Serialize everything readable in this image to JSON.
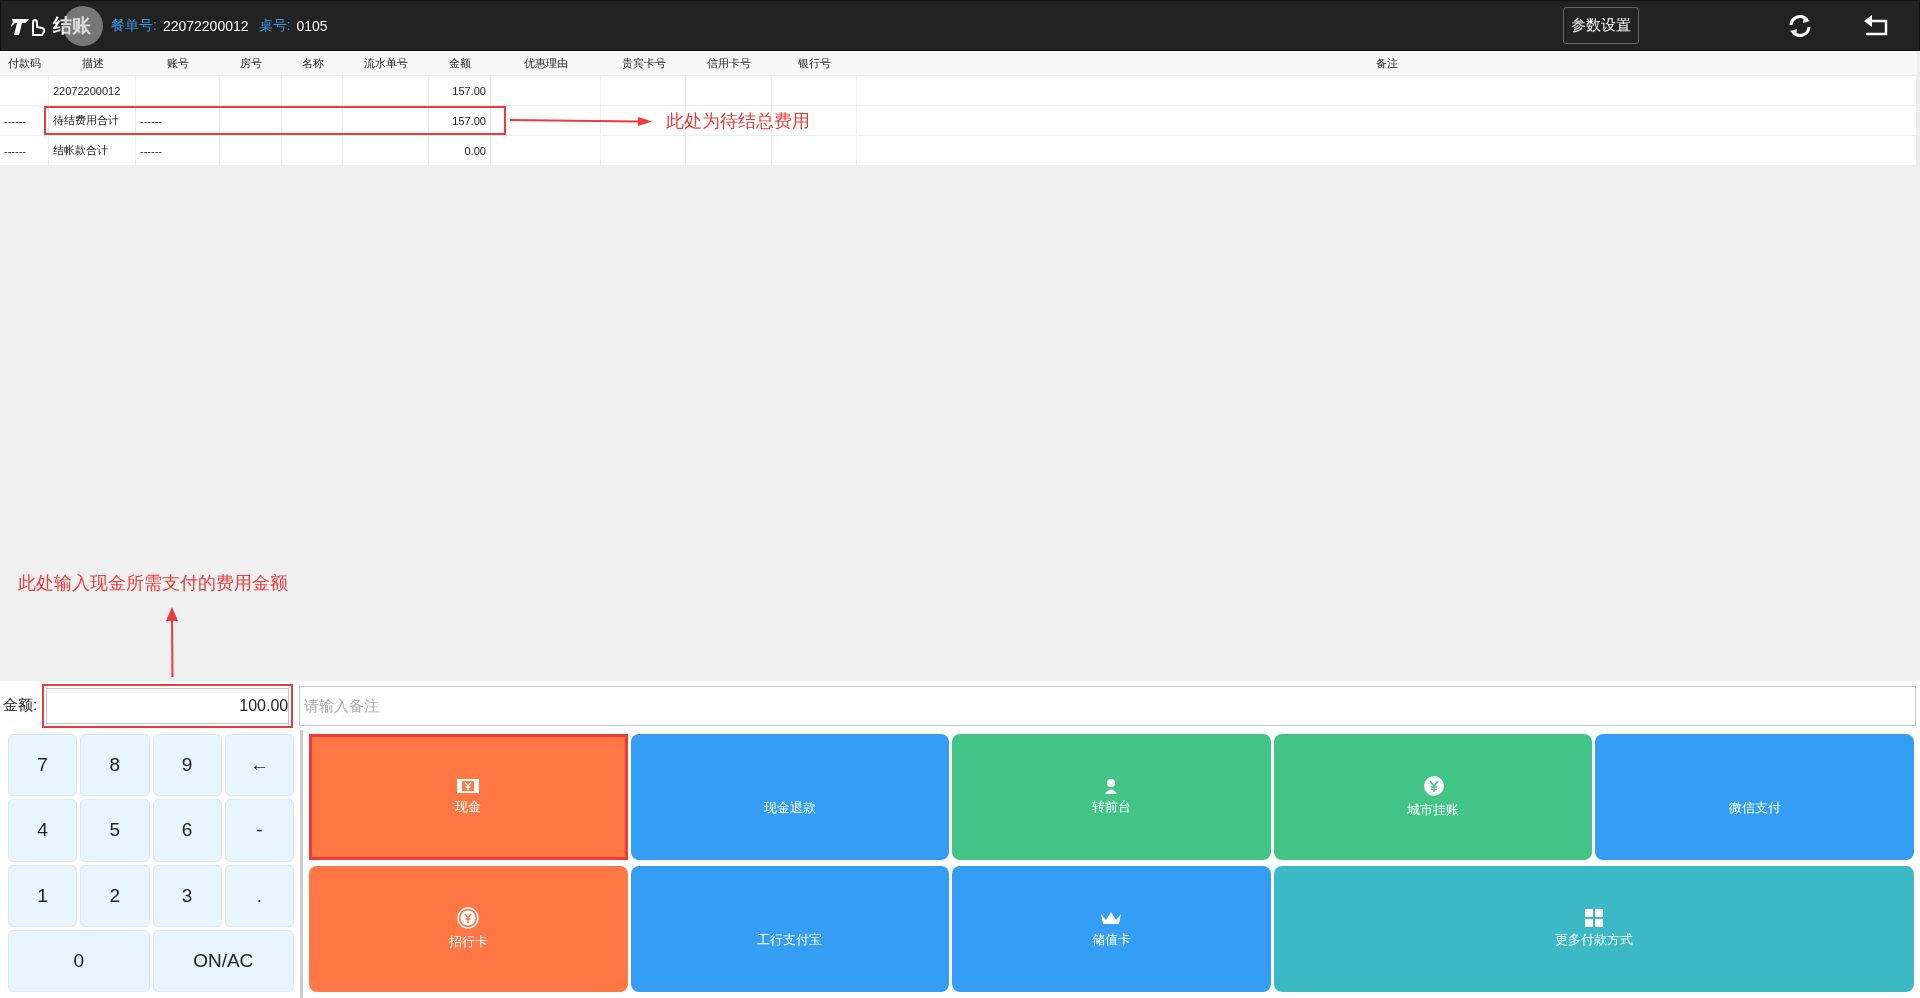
{
  "header": {
    "title": "结账",
    "order_label": "餐单号:",
    "order_no": "22072200012",
    "table_label": "桌号:",
    "table_no": "0105",
    "settings_button": "参数设置"
  },
  "table": {
    "columns": [
      "付款码",
      "描述",
      "账号",
      "房号",
      "名称",
      "流水单号",
      "金额",
      "优惠理由",
      "贵宾卡号",
      "信用卡号",
      "银行号",
      "备注"
    ],
    "rows": [
      {
        "annotated": false,
        "cells": [
          "",
          "22072200012",
          "",
          "",
          "",
          "",
          "157.00",
          "",
          "",
          "",
          "",
          ""
        ]
      },
      {
        "annotated": true,
        "cells": [
          "------",
          "待结费用合计",
          "------",
          "",
          "",
          "",
          "157.00",
          "",
          "",
          "",
          "",
          ""
        ]
      },
      {
        "annotated": false,
        "cells": [
          "------",
          "结帐款合计",
          "------",
          "",
          "",
          "",
          "0.00",
          "",
          "",
          "",
          "",
          ""
        ]
      }
    ]
  },
  "annotations": [
    {
      "text": "此处为待结总费用"
    },
    {
      "text": "此处输入现金所需支付的费用金额"
    }
  ],
  "amount": {
    "label": "金额:",
    "value": "100.00",
    "annotated": true
  },
  "memo": {
    "placeholder": "请输入备注"
  },
  "keypad": [
    {
      "label": "7",
      "wide": false
    },
    {
      "label": "8",
      "wide": false
    },
    {
      "label": "9",
      "wide": false
    },
    {
      "label": "←",
      "wide": false
    },
    {
      "label": "4",
      "wide": false
    },
    {
      "label": "5",
      "wide": false
    },
    {
      "label": "6",
      "wide": false
    },
    {
      "label": "-",
      "wide": false
    },
    {
      "label": "1",
      "wide": false
    },
    {
      "label": "2",
      "wide": false
    },
    {
      "label": "3",
      "wide": false
    },
    {
      "label": ".",
      "wide": false
    },
    {
      "label": "0",
      "wide": true
    },
    {
      "label": "ON/AC",
      "wide": true
    }
  ],
  "payments": [
    {
      "label": "现金",
      "kind": "cash",
      "color": "#ff7744",
      "selected": true,
      "wide": false
    },
    {
      "label": "现金退款",
      "kind": "plain",
      "color": "#349ef5",
      "selected": false,
      "wide": false
    },
    {
      "label": "转前台",
      "kind": "person",
      "color": "#43c487",
      "selected": false,
      "wide": false
    },
    {
      "label": "城市挂账",
      "kind": "yen",
      "color": "#43c487",
      "selected": false,
      "wide": false
    },
    {
      "label": "微信支付",
      "kind": "plain",
      "color": "#349ef5",
      "selected": false,
      "wide": false
    },
    {
      "label": "招行卡",
      "kind": "coin",
      "color": "#ff7744",
      "selected": false,
      "wide": false
    },
    {
      "label": "工行支付宝",
      "kind": "plain",
      "color": "#349ef5",
      "selected": false,
      "wide": false
    },
    {
      "label": "储值卡",
      "kind": "crown",
      "color": "#349ef5",
      "selected": false,
      "wide": false
    },
    {
      "label": "更多付款方式",
      "kind": "grid",
      "color": "#3bbac6",
      "selected": false,
      "wide": true
    }
  ]
}
